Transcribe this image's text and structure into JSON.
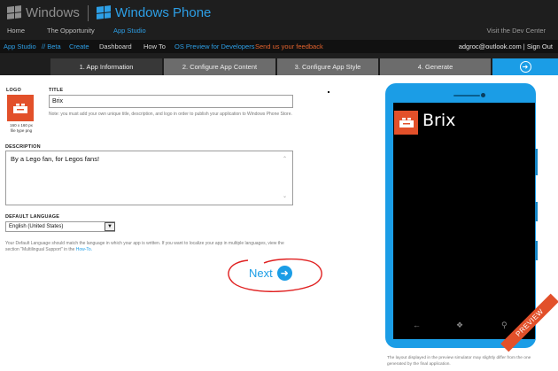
{
  "header": {
    "brand_windows": "Windows",
    "brand_phone": "Windows Phone",
    "nav": [
      "Home",
      "The Opportunity",
      "App Studio"
    ],
    "dev_center": "Visit the Dev Center"
  },
  "subnav": {
    "app_studio": "App Studio",
    "beta": "// Beta",
    "create": "Create",
    "dashboard": "Dashboard",
    "howto": "How To",
    "os_preview": "OS Preview for Developers",
    "feedback": "Send us your feedback",
    "user": "adgroc@outlook.com",
    "signout": "| Sign Out"
  },
  "steps": [
    "1. App Information",
    "2. Configure App Content",
    "3. Configure App Style",
    "4. Generate"
  ],
  "form": {
    "logo_label": "LOGO",
    "logo_caption_1": "160 x 160 px",
    "logo_caption_2": "file type png",
    "title_label": "TITLE",
    "title_value": "Brix",
    "title_note": "Note: you must add your own unique title, description, and logo in order to publish your application to Windows Phone Store.",
    "description_label": "DESCRIPTION",
    "description_value": "By a Lego fan, for Legos fans!",
    "language_label": "DEFAULT LANGUAGE",
    "language_value": "English (United States)",
    "language_note": "Your Default Language should match the language in which your app is written. If you want to localize your app in multiple languages, view the section \"Multilingual Support\" in the",
    "language_note_link": "How-To.",
    "next_label": "Next"
  },
  "preview": {
    "app_name": "Brix",
    "ribbon": "PREVIEW",
    "note": "The layout displayed in the preview simulator may slightly differ from the one generated by the final application."
  },
  "colors": {
    "accent_blue": "#1b9de6",
    "tile_orange": "#e2502a",
    "feedback_orange": "#e2622d",
    "annotation_red": "#e02020"
  },
  "icons": [
    "windows-logo-icon",
    "arrow-right-circle-icon",
    "brick-icon",
    "back-icon",
    "start-icon",
    "search-icon",
    "chevron-down-icon"
  ]
}
